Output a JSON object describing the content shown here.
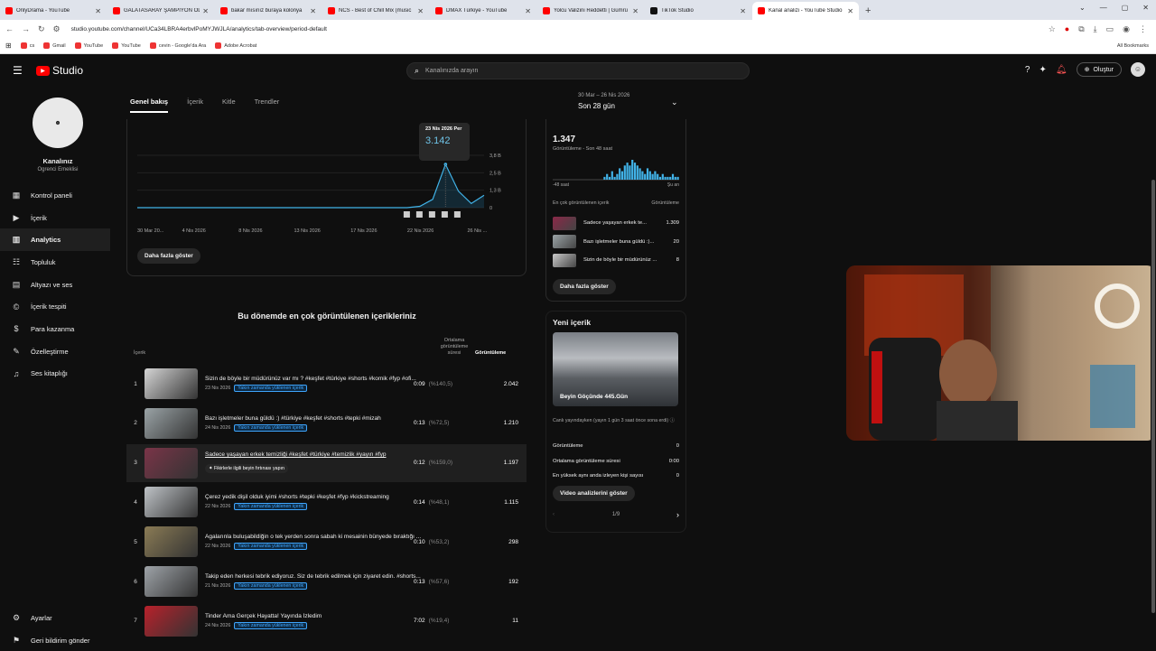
{
  "browser": {
    "tabs": [
      {
        "title": "OnlyDrama - YouTube",
        "active": false
      },
      {
        "title": "GALATASARAY ŞAMPİYON OLM",
        "active": false
      },
      {
        "title": "bakar mısınız buraya kolonya",
        "active": false
      },
      {
        "title": "NCS - Best of Chill Mix (music",
        "active": false
      },
      {
        "title": "DMAX Türkiye - YouTube",
        "active": false
      },
      {
        "title": "Yolcu Valizini Reddetti | Gümrü",
        "active": false
      },
      {
        "title": "TikTok Studio",
        "active": false
      },
      {
        "title": "Kanal analizi - YouTube Studio",
        "active": true
      }
    ],
    "url": "studio.youtube.com/channel/UCa34LBRA4erbvlPoMYJWJLA/analytics/tab-overview/period-default",
    "bookmarks": [
      "cs",
      "Gmail",
      "YouTube",
      "YouTube",
      "cevin - Google'da Ara",
      "Adobe Acrobat"
    ],
    "all_bookmarks": "All Bookmarks"
  },
  "topbar": {
    "logo": "Studio",
    "search_placeholder": "Kanalınızda arayın",
    "create_label": "Oluştur"
  },
  "sidebar": {
    "channel_name": "Kanalınız",
    "channel_sub": "Ogrenci Emeklisi",
    "items": [
      {
        "label": "Kontrol paneli",
        "icon": "dashboard-icon"
      },
      {
        "label": "İçerik",
        "icon": "content-icon"
      },
      {
        "label": "Analytics",
        "icon": "analytics-icon",
        "selected": true
      },
      {
        "label": "Topluluk",
        "icon": "community-icon"
      },
      {
        "label": "Altyazı ve ses",
        "icon": "subtitles-icon"
      },
      {
        "label": "İçerik tespiti",
        "icon": "copyright-icon"
      },
      {
        "label": "Para kazanma",
        "icon": "monetization-icon"
      },
      {
        "label": "Özelleştirme",
        "icon": "customization-icon"
      },
      {
        "label": "Ses kitaplığı",
        "icon": "audio-library-icon"
      }
    ],
    "settings": "Ayarlar",
    "feedback": "Geri bildirim gönder"
  },
  "main": {
    "tabs": [
      "Genel bakış",
      "İçerik",
      "Kitle",
      "Trendler"
    ],
    "period_range": "30 Mar – 26 Nis 2026",
    "period_label": "Son 28 gün",
    "tooltip_date": "23 Nis 2026 Per",
    "tooltip_value": "3.142",
    "show_more": "Daha fazla göster",
    "top_title": "Bu dönemde en çok görüntülenen içerikleriniz",
    "col_content": "İçerik",
    "col_avg": "Ortalama görüntüleme süresi",
    "col_views": "Görüntüleme",
    "recent_tag": "Yakın zamanda yüklenen içerik",
    "videos": [
      {
        "rank": "1",
        "title": "Sizin de böyle bir müdürünüz var mı ? #keşfet #türkiye #shorts #komik #fyp #ofi...",
        "date": "23 Nis 2026",
        "duration": "0:09",
        "pct": "(%140,5)",
        "views": "2.042",
        "tagged": true
      },
      {
        "rank": "2",
        "title": "Bazı işletmeler buna güldü :) #türkiye #keşfet #shorts #tepki #mizah",
        "date": "24 Nis 2026",
        "duration": "0:13",
        "pct": "(%72,5)",
        "views": "1.210",
        "tagged": true
      },
      {
        "rank": "3",
        "title": "Sadece yaşayan erkek temizliği #keşfet #türkiye #temizlik #yayın #fyp",
        "date": "",
        "duration": "0:12",
        "pct": "(%159,0)",
        "views": "1.197",
        "tagged": false,
        "chip": "Fikirlerle ilgili beyin fırtınası yapın"
      },
      {
        "rank": "4",
        "title": "Çerez yedik dişil olduk iyimi #shorts #tepki #keşfet #fyp #kickstreaming",
        "date": "22 Nis 2026",
        "duration": "0:14",
        "pct": "(%48,1)",
        "views": "1.115",
        "tagged": true
      },
      {
        "rank": "5",
        "title": "Agalarınla buluşabildiğin o tek yerden sonra sabah ki mesainin bünyede bıraktığı ...",
        "date": "22 Nis 2026",
        "duration": "0:10",
        "pct": "(%53,2)",
        "views": "298",
        "tagged": true
      },
      {
        "rank": "6",
        "title": "Takip eden herkesi tebrik ediyoruz. Siz de tebrik edilmek için ziyaret edin. #shorts...",
        "date": "21 Nis 2026",
        "duration": "0:13",
        "pct": "(%57,6)",
        "views": "192",
        "tagged": true
      },
      {
        "rank": "7",
        "title": "Tinder Ama Gerçek Hayatta! Yayında İzledim",
        "date": "24 Nis 2026",
        "duration": "7:02",
        "pct": "(%19,4)",
        "views": "11",
        "tagged": true
      }
    ]
  },
  "chart_data": {
    "type": "line",
    "x_labels": [
      "30 Mar 20...",
      "4 Nis 2026",
      "8 Nis 2026",
      "13 Nis 2026",
      "17 Nis 2026",
      "22 Nis 2026",
      "26 Nis ..."
    ],
    "y_ticks": [
      "3,8 B",
      "2,5 B",
      "1,3 B",
      "0"
    ],
    "ylim": [
      0,
      3800
    ],
    "series": [
      {
        "values": [
          0,
          0,
          0,
          0,
          0,
          0,
          0,
          0,
          0,
          0,
          0,
          0,
          0,
          0,
          0,
          0,
          0,
          0,
          0,
          0,
          0,
          0,
          100,
          600,
          3142,
          1200,
          300,
          900
        ]
      }
    ],
    "grid": true
  },
  "realtime": {
    "views": "1.347",
    "label": "Görüntüleme - Son 48 saat",
    "left": "-48 saat",
    "right": "Şu an",
    "bars": [
      0,
      0,
      0,
      0,
      0,
      0,
      0,
      0,
      0,
      0,
      0,
      0,
      0,
      0,
      0,
      0,
      0,
      0,
      0,
      0,
      1,
      2,
      1,
      3,
      1,
      2,
      4,
      3,
      5,
      6,
      5,
      7,
      6,
      5,
      4,
      3,
      2,
      4,
      3,
      2,
      3,
      2,
      1,
      2,
      1,
      1,
      1,
      2,
      1,
      1
    ],
    "top_head": "En çok görüntülenen içerik",
    "top_head_right": "Görüntüleme",
    "top": [
      {
        "title": "Sadece yaşayan erkek te...",
        "views": "1.309"
      },
      {
        "title": "Bazı işletmeler buna güldü :)...",
        "views": "20"
      },
      {
        "title": "Sizin de böyle bir müdürünüz ...",
        "views": "8"
      }
    ],
    "show_more": "Daha fazla göster"
  },
  "latest": {
    "heading": "Yeni içerik",
    "video_title": "Beyin Göçünde 445.Gün",
    "live_note": "Canlı yayındayken (yayın 1 gün 3 saat önce sona erdi)",
    "stats": [
      {
        "label": "Görüntüleme",
        "value": "0"
      },
      {
        "label": "Ortalama görüntüleme süresi",
        "value": "0:00"
      },
      {
        "label": "En yüksek aynı anda izleyen kişi sayısı",
        "value": "0"
      }
    ],
    "button": "Video analizlerini göster",
    "pager": "1/9"
  }
}
